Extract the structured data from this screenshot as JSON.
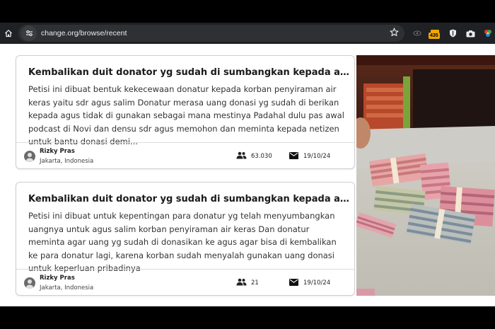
{
  "browser": {
    "url": "change.org/browse/recent",
    "extension_badge": "435"
  },
  "petitions": [
    {
      "title": "Kembalikan duit donator yg sudah di sumbangkan kepada agus korban penyiraman air keras",
      "description": "Petisi ini dibuat bentuk kekecewaan donatur kepada korban penyiraman air keras yaitu sdr agus salim Donatur merasa uang donasi yg sudah di berikan kepada agus tidak di gunakan sebagai mana mestinya Padahal dulu pas awal podcast di Novi dan densu sdr agus memohon dan meminta kepada netizen untuk bantu donasi demi...",
      "author": "Rizky Pras",
      "location": "Jakarta, Indonesia",
      "supporters": "63.030",
      "date": "19/10/24"
    },
    {
      "title": "Kembalikan duit donator yg sudah di sumbangkan kepada agus korban penyiraman air keras",
      "description": "Petisi ini dibuat untuk kepentingan para donatur yg telah menyumbangkan uangnya untuk agus salim korban penyiraman air keras Dan donatur meminta agar uang yg sudah di donasikan ke agus agar bisa di kembalikan ke para donatur lagi, karena korban sudah menyalah gunakan uang donasi untuk keperluan pribadinya",
      "author": "Rizky Pras",
      "location": "Jakarta, Indonesia",
      "supporters": "21",
      "date": "19/10/24"
    }
  ],
  "icons": {
    "home": "home-icon",
    "site_info": "site-info-icon",
    "bookmark": "star-icon",
    "supporters": "people-icon",
    "date": "mail-icon",
    "avatar": "avatar-icon"
  },
  "colors": {
    "toolbar_bg": "#202124",
    "omnibox_bg": "#2f3033",
    "card_border": "#cfcfcf",
    "text_dark": "#1a1a1a"
  }
}
